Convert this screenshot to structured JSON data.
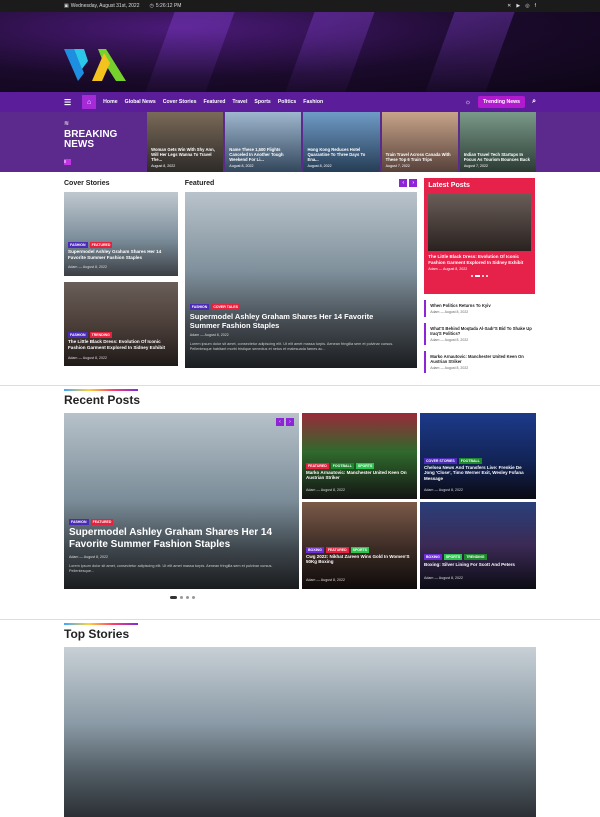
{
  "topbar": {
    "date": "Wednesday, August 31st, 2022",
    "time": "5:26:12 PM"
  },
  "nav": {
    "items": [
      "Home",
      "Global News",
      "Cover Stories",
      "Featured",
      "Travel",
      "Sports",
      "Politics",
      "Fashion"
    ],
    "trending": "Trending News"
  },
  "breaking": {
    "title": "BREAKING NEWS",
    "cards": [
      {
        "title": "Woman Gets Win With Shy Ann, Will Her Legs Wanna To Travel The...",
        "date": "August 8, 2022"
      },
      {
        "title": "Name These 1,500 Flights Canceled In Another Tough Weekend For Li...",
        "date": "August 8, 2022"
      },
      {
        "title": "Hong Kong Reduces Hotel Quarantine To Three Days To Ena...",
        "date": "August 8, 2022"
      },
      {
        "title": "Train Travel Across Canada With These Top 6 Train Trips",
        "date": "August 7, 2022"
      },
      {
        "title": "Indian Travel Tech Startups In Focus As Tourism Bounces Back",
        "date": "August 7, 2022"
      }
    ]
  },
  "cover": {
    "heading": "Cover Stories",
    "cards": [
      {
        "tags": [
          "FASHION",
          "FEATURED"
        ],
        "title": "Supermodel Ashley Graham Shares Her 14 Favorite Summer Fashion Staples",
        "author": "Adam",
        "date": "August 8, 2022"
      },
      {
        "tags": [
          "FASHION",
          "TRENDING"
        ],
        "title": "The Little Black Dress: Evolution Of Iconic Fashion Garment Explored In Sidney Exhibit",
        "author": "Adam",
        "date": "August 8, 2022"
      }
    ]
  },
  "featured": {
    "heading": "Featured",
    "tags": [
      "FASHION",
      "COVER TALES"
    ],
    "title": "Supermodel Ashley Graham Shares Her 14 Favorite Summer Fashion Staples",
    "author": "Adam",
    "date": "August 8, 2022",
    "excerpt": "Lorem ipsum dolor sit amet, consectetur adipiscing elit. Ut elit amet massa turpis. Aenean fringilla sem et pulvinar cursus. Pellentesque habitant morbi tristique senectus et netus et malesuada fames ac..."
  },
  "latest": {
    "heading": "Latest Posts",
    "top": {
      "title": "The Little Black Dress: Evolution Of Iconic Fashion Garment Explored In Sidney Exhibit",
      "author": "Adam",
      "date": "August 8, 2022"
    },
    "items": [
      {
        "title": "When Politics Returns To Kyiv",
        "author": "Adam",
        "date": "August 8, 2022"
      },
      {
        "title": "What'S Behind Moqtada Al-Sadr'S Bid To Shake Up Iraq'S Politics?",
        "author": "Adam",
        "date": "August 8, 2022"
      },
      {
        "title": "Marko Arnautovic: Manchester United Keen On Austrian Striker",
        "author": "Adam",
        "date": "August 8, 2022"
      }
    ]
  },
  "recent": {
    "heading": "Recent Posts",
    "main": {
      "tags": [
        "FASHION",
        "FEATURED"
      ],
      "title": "Supermodel Ashley Graham Shares Her 14 Favorite Summer Fashion Staples",
      "author": "Adam",
      "date": "August 8, 2022",
      "excerpt": "Lorem ipsum dolor sit amet, consectetur adipiscing elit. Ut elit amet massa turpis. Aenean fringilla sem et pulvinar cursus. Pellentesque..."
    },
    "grid": [
      {
        "tags": [
          "FEATURED",
          "FOOTBALL",
          "SPORTS"
        ],
        "title": "Marko Arnautovic: Manchester United Keen On Austrian Striker",
        "author": "Adam",
        "date": "August 8, 2022"
      },
      {
        "tags": [
          "COVER STORIES",
          "FOOTBALL"
        ],
        "title": "Chelsea News And Transfers Live: Frenkie De Jong 'Close', Timo Werner Exit, Wesley Fofana Message",
        "author": "Adam",
        "date": "August 8, 2022"
      },
      {
        "tags": [
          "BOXING",
          "FEATURED",
          "SPORTS"
        ],
        "title": "Cwg 2022: Nikhat Zareen Wins Gold In Women'S 50Kg Boxing",
        "author": "Adam",
        "date": "August 8, 2022"
      },
      {
        "tags": [
          "BOXING",
          "SPORTS",
          "TRENDING"
        ],
        "title": "Boxing: Silver Lining For Scott And Peters",
        "author": "Adam",
        "date": "August 8, 2022"
      }
    ]
  },
  "top": {
    "heading": "Top Stories"
  }
}
